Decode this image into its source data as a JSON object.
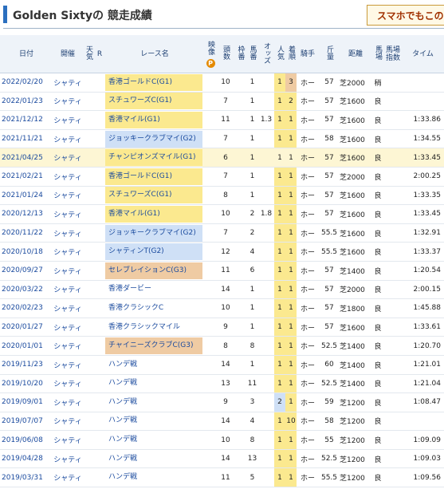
{
  "title": "Golden Sixtyの 競走成績",
  "promo_button": "スマホでもこの",
  "p_badge": "P",
  "colors": {
    "g1": "#fbe98f",
    "g2": "#cfe0f6",
    "g3": "#efcba3",
    "header": "#eef3f9",
    "accent": "#2b6fbf"
  },
  "columns": {
    "date": "日付",
    "venue": "開催",
    "weather": "天気",
    "r": "R",
    "race": "レース名",
    "video": "映像",
    "runners": "頭数",
    "frame": "枠番",
    "horse_no": "馬番",
    "odds": "オッズ",
    "popularity": "人気",
    "finish": "着順",
    "jockey": "騎手",
    "weight": "斤量",
    "distance": "距離",
    "track": "馬場",
    "index": "馬場指数",
    "time": "タイム"
  },
  "rows": [
    {
      "date": "2022/02/20",
      "venue": "シャティ",
      "race": "香港ゴールドC(G1)",
      "grade": "g1",
      "runners": "10",
      "frame": "",
      "horse_no": "1",
      "odds": "",
      "pop": "1",
      "finish": "3",
      "jockey": "ホー",
      "weight": "57",
      "dist": "芝2000",
      "track": "稍",
      "time": "",
      "hl": false
    },
    {
      "date": "2022/01/23",
      "venue": "シャティ",
      "race": "スチュワーズC(G1)",
      "grade": "g1",
      "runners": "7",
      "frame": "",
      "horse_no": "1",
      "odds": "",
      "pop": "1",
      "finish": "2",
      "jockey": "ホー",
      "weight": "57",
      "dist": "芝1600",
      "track": "良",
      "time": "",
      "hl": false
    },
    {
      "date": "2021/12/12",
      "venue": "シャティ",
      "race": "香港マイル(G1)",
      "grade": "g1",
      "runners": "11",
      "frame": "",
      "horse_no": "1",
      "odds": "1.3",
      "pop": "1",
      "finish": "1",
      "jockey": "ホー",
      "weight": "57",
      "dist": "芝1600",
      "track": "良",
      "time": "1:33.86",
      "hl": false
    },
    {
      "date": "2021/11/21",
      "venue": "シャティ",
      "race": "ジョッキークラブマイ(G2)",
      "grade": "g2",
      "runners": "7",
      "frame": "",
      "horse_no": "1",
      "odds": "",
      "pop": "1",
      "finish": "1",
      "jockey": "ホー",
      "weight": "58",
      "dist": "芝1600",
      "track": "良",
      "time": "1:34.55",
      "hl": false
    },
    {
      "date": "2021/04/25",
      "venue": "シャティ",
      "race": "チャンピオンズマイル(G1)",
      "grade": "g1",
      "runners": "6",
      "frame": "",
      "horse_no": "1",
      "odds": "",
      "pop": "1",
      "finish": "1",
      "jockey": "ホー",
      "weight": "57",
      "dist": "芝1600",
      "track": "良",
      "time": "1:33.45",
      "hl": true
    },
    {
      "date": "2021/02/21",
      "venue": "シャティ",
      "race": "香港ゴールドC(G1)",
      "grade": "g1",
      "runners": "7",
      "frame": "",
      "horse_no": "1",
      "odds": "",
      "pop": "1",
      "finish": "1",
      "jockey": "ホー",
      "weight": "57",
      "dist": "芝2000",
      "track": "良",
      "time": "2:00.25",
      "hl": false
    },
    {
      "date": "2021/01/24",
      "venue": "シャティ",
      "race": "スチュワーズC(G1)",
      "grade": "g1",
      "runners": "8",
      "frame": "",
      "horse_no": "1",
      "odds": "",
      "pop": "1",
      "finish": "1",
      "jockey": "ホー",
      "weight": "57",
      "dist": "芝1600",
      "track": "良",
      "time": "1:33.35",
      "hl": false
    },
    {
      "date": "2020/12/13",
      "venue": "シャティ",
      "race": "香港マイル(G1)",
      "grade": "g1",
      "runners": "10",
      "frame": "",
      "horse_no": "2",
      "odds": "1.8",
      "pop": "1",
      "finish": "1",
      "jockey": "ホー",
      "weight": "57",
      "dist": "芝1600",
      "track": "良",
      "time": "1:33.45",
      "hl": false
    },
    {
      "date": "2020/11/22",
      "venue": "シャティ",
      "race": "ジョッキークラブマイ(G2)",
      "grade": "g2",
      "runners": "7",
      "frame": "",
      "horse_no": "2",
      "odds": "",
      "pop": "1",
      "finish": "1",
      "jockey": "ホー",
      "weight": "55.5",
      "dist": "芝1600",
      "track": "良",
      "time": "1:32.91",
      "hl": false
    },
    {
      "date": "2020/10/18",
      "venue": "シャティ",
      "race": "シャティンT(G2)",
      "grade": "g2",
      "runners": "12",
      "frame": "",
      "horse_no": "4",
      "odds": "",
      "pop": "1",
      "finish": "1",
      "jockey": "ホー",
      "weight": "55.5",
      "dist": "芝1600",
      "track": "良",
      "time": "1:33.37",
      "hl": false
    },
    {
      "date": "2020/09/27",
      "venue": "シャティ",
      "race": "セレブレイションC(G3)",
      "grade": "g3",
      "runners": "11",
      "frame": "",
      "horse_no": "6",
      "odds": "",
      "pop": "1",
      "finish": "1",
      "jockey": "ホー",
      "weight": "57",
      "dist": "芝1400",
      "track": "良",
      "time": "1:20.54",
      "hl": false
    },
    {
      "date": "2020/03/22",
      "venue": "シャティ",
      "race": "香港ダービー",
      "grade": "",
      "runners": "14",
      "frame": "",
      "horse_no": "1",
      "odds": "",
      "pop": "1",
      "finish": "1",
      "jockey": "ホー",
      "weight": "57",
      "dist": "芝2000",
      "track": "良",
      "time": "2:00.15",
      "hl": false
    },
    {
      "date": "2020/02/23",
      "venue": "シャティ",
      "race": "香港クラシックC",
      "grade": "",
      "runners": "10",
      "frame": "",
      "horse_no": "1",
      "odds": "",
      "pop": "1",
      "finish": "1",
      "jockey": "ホー",
      "weight": "57",
      "dist": "芝1800",
      "track": "良",
      "time": "1:45.88",
      "hl": false
    },
    {
      "date": "2020/01/27",
      "venue": "シャティ",
      "race": "香港クラシックマイル",
      "grade": "",
      "runners": "9",
      "frame": "",
      "horse_no": "1",
      "odds": "",
      "pop": "1",
      "finish": "1",
      "jockey": "ホー",
      "weight": "57",
      "dist": "芝1600",
      "track": "良",
      "time": "1:33.61",
      "hl": false
    },
    {
      "date": "2020/01/01",
      "venue": "シャティ",
      "race": "チャイニーズクラブC(G3)",
      "grade": "g3",
      "runners": "8",
      "frame": "",
      "horse_no": "8",
      "odds": "",
      "pop": "1",
      "finish": "1",
      "jockey": "ホー",
      "weight": "52.5",
      "dist": "芝1400",
      "track": "良",
      "time": "1:20.70",
      "hl": false
    },
    {
      "date": "2019/11/23",
      "venue": "シャティ",
      "race": "ハンデ戦",
      "grade": "",
      "runners": "14",
      "frame": "",
      "horse_no": "1",
      "odds": "",
      "pop": "1",
      "finish": "1",
      "jockey": "ホー",
      "weight": "60",
      "dist": "芝1400",
      "track": "良",
      "time": "1:21.01",
      "hl": false
    },
    {
      "date": "2019/10/20",
      "venue": "シャティ",
      "race": "ハンデ戦",
      "grade": "",
      "runners": "13",
      "frame": "",
      "horse_no": "11",
      "odds": "",
      "pop": "1",
      "finish": "1",
      "jockey": "ホー",
      "weight": "52.5",
      "dist": "芝1400",
      "track": "良",
      "time": "1:21.04",
      "hl": false
    },
    {
      "date": "2019/09/01",
      "venue": "シャティ",
      "race": "ハンデ戦",
      "grade": "",
      "runners": "9",
      "frame": "",
      "horse_no": "3",
      "odds": "",
      "pop": "2",
      "finish": "1",
      "jockey": "ホー",
      "weight": "59",
      "dist": "芝1200",
      "track": "良",
      "time": "1:08.47",
      "hl": false,
      "pop_blue": true
    },
    {
      "date": "2019/07/07",
      "venue": "シャティ",
      "race": "ハンデ戦",
      "grade": "",
      "runners": "14",
      "frame": "",
      "horse_no": "4",
      "odds": "",
      "pop": "1",
      "finish": "10",
      "jockey": "ホー",
      "weight": "58",
      "dist": "芝1200",
      "track": "良",
      "time": "",
      "hl": false
    },
    {
      "date": "2019/06/08",
      "venue": "シャティ",
      "race": "ハンデ戦",
      "grade": "",
      "runners": "10",
      "frame": "",
      "horse_no": "8",
      "odds": "",
      "pop": "1",
      "finish": "1",
      "jockey": "ホー",
      "weight": "55",
      "dist": "芝1200",
      "track": "良",
      "time": "1:09.09",
      "hl": false
    },
    {
      "date": "2019/04/28",
      "venue": "シャティ",
      "race": "ハンデ戦",
      "grade": "",
      "runners": "14",
      "frame": "",
      "horse_no": "13",
      "odds": "",
      "pop": "1",
      "finish": "1",
      "jockey": "ホー",
      "weight": "52.5",
      "dist": "芝1200",
      "track": "良",
      "time": "1:09.03",
      "hl": false
    },
    {
      "date": "2019/03/31",
      "venue": "シャティ",
      "race": "ハンデ戦",
      "grade": "",
      "runners": "11",
      "frame": "",
      "horse_no": "5",
      "odds": "",
      "pop": "1",
      "finish": "1",
      "jockey": "ホー",
      "weight": "55.5",
      "dist": "芝1200",
      "track": "良",
      "time": "1:09.56",
      "hl": false
    }
  ]
}
